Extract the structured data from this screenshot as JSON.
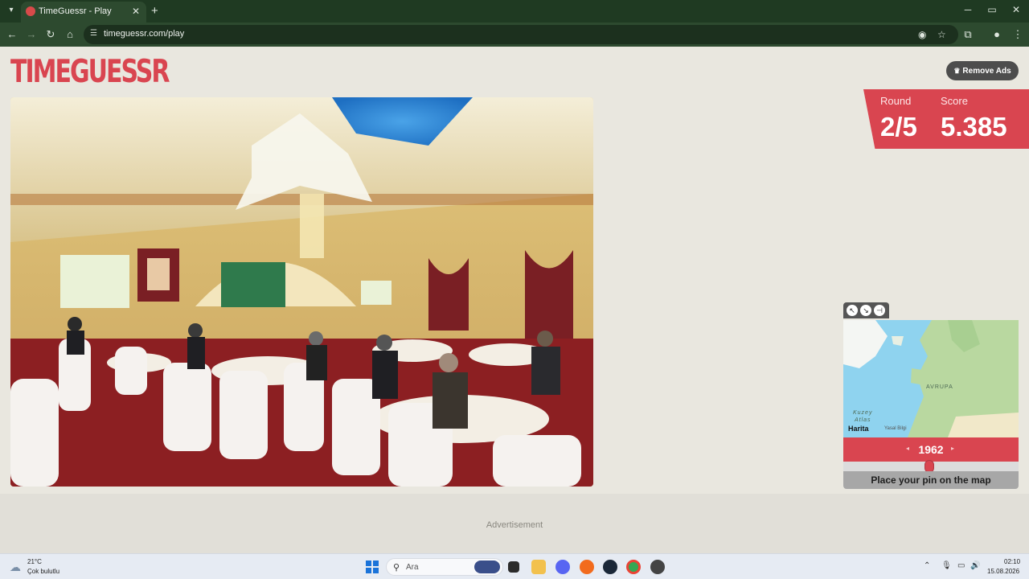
{
  "browser": {
    "tab_title": "TimeGuessr - Play",
    "url": "timeguessr.com/play",
    "new_tab": "+",
    "minimize": "─",
    "restore": "▭",
    "close": "✕"
  },
  "page": {
    "logo": "TIMEGUESSR",
    "remove_ads": "Remove Ads",
    "round_label": "Round",
    "round_value": "2/5",
    "score_label": "Score",
    "score_value": "5.385",
    "map": {
      "region_label": "AVRUPA",
      "ocean_label_line1": "Kuzey",
      "ocean_label_line2": "Atlas",
      "attribution": "Harita",
      "legal": "Yasal Bilgi"
    },
    "year": "1962",
    "place_pin": "Place your pin on the map",
    "advertisement": "Advertisement"
  },
  "taskbar": {
    "temperature": "21°C",
    "weather": "Çok bulutlu",
    "search_placeholder": "Ara",
    "time": "02:10",
    "date": "15.08.2026"
  },
  "colors": {
    "brand_red": "#d94550",
    "browser_green": "#2d4a2f",
    "page_bg": "#e9e7df"
  }
}
